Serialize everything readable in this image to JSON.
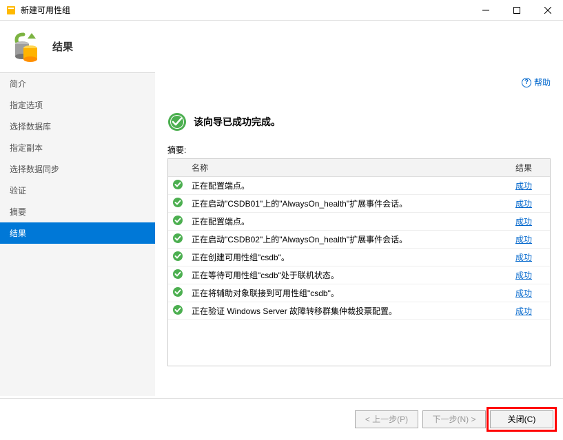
{
  "window": {
    "title": "新建可用性组"
  },
  "header": {
    "title": "结果"
  },
  "sidebar": {
    "items": [
      {
        "label": "简介"
      },
      {
        "label": "指定选项"
      },
      {
        "label": "选择数据库"
      },
      {
        "label": "指定副本"
      },
      {
        "label": "选择数据同步"
      },
      {
        "label": "验证"
      },
      {
        "label": "摘要"
      },
      {
        "label": "结果"
      }
    ],
    "activeIndex": 7
  },
  "main": {
    "help_label": "帮助",
    "success_message": "该向导已成功完成。",
    "summary_label": "摘要:",
    "columns": {
      "name": "名称",
      "result": "结果"
    },
    "rows": [
      {
        "name": "正在配置端点。",
        "result": "成功"
      },
      {
        "name": "正在启动\"CSDB01\"上的\"AlwaysOn_health\"扩展事件会话。",
        "result": "成功"
      },
      {
        "name": "正在配置端点。",
        "result": "成功"
      },
      {
        "name": "正在启动\"CSDB02\"上的\"AlwaysOn_health\"扩展事件会话。",
        "result": "成功"
      },
      {
        "name": "正在创建可用性组\"csdb\"。",
        "result": "成功"
      },
      {
        "name": "正在等待可用性组\"csdb\"处于联机状态。",
        "result": "成功"
      },
      {
        "name": "正在将辅助对象联接到可用性组\"csdb\"。",
        "result": "成功"
      },
      {
        "name": "正在验证 Windows Server 故障转移群集仲裁投票配置。",
        "result": "成功"
      }
    ]
  },
  "footer": {
    "prev": "< 上一步(P)",
    "next": "下一步(N) >",
    "close": "关闭(C)"
  }
}
